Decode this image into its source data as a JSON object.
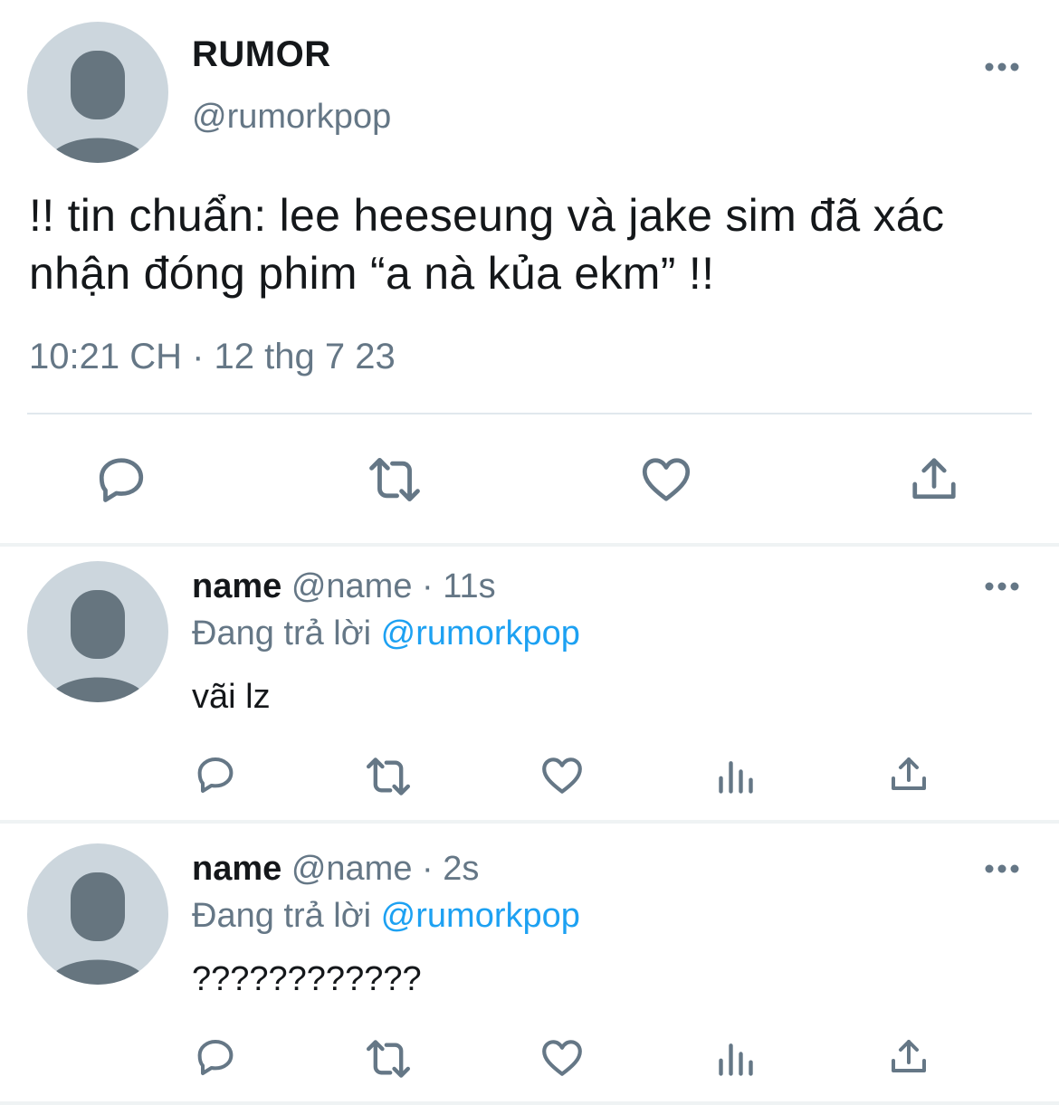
{
  "main_tweet": {
    "display_name": "RUMOR",
    "handle": "@rumorkpop",
    "text_line1": "!! tin chuẩn: lee heeseung và jake sim đã xác",
    "text_line2": "nhận đóng phim “a nà kủa ekm” !!",
    "timestamp": "10:21 CH · 12 thg 7 23",
    "avatar_icon": "default-avatar-icon",
    "more_icon": "more-options-icon",
    "actions": [
      "reply-icon",
      "retweet-icon",
      "like-icon",
      "share-icon"
    ]
  },
  "replies": [
    {
      "name": "name",
      "meta": " @name · 11s",
      "replying_label": "Đang trả lời ",
      "replying_to": "@rumorkpop",
      "text": "vãi lz"
    },
    {
      "name": "name",
      "meta": " @name · 2s",
      "replying_label": "Đang trả lời ",
      "replying_to": "@rumorkpop",
      "text": "????????????"
    }
  ],
  "colors": {
    "text": "#14171a",
    "secondary": "#657786",
    "link": "#1da1f2",
    "avatar_bg": "#ccd6dd",
    "avatar_fg": "#66757f",
    "divider": "#e1e8ed"
  }
}
